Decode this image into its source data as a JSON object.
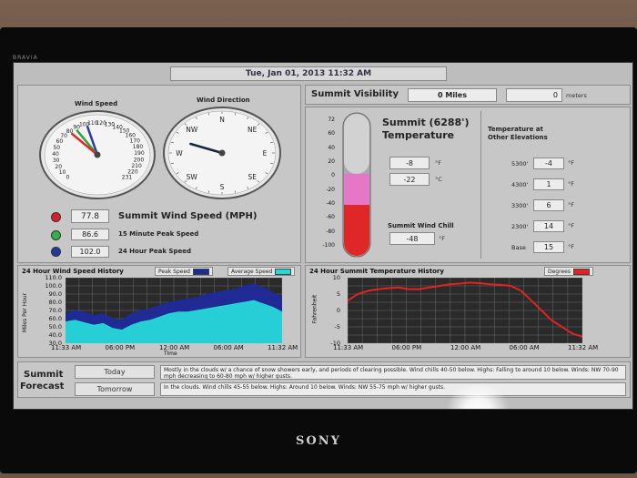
{
  "tv": {
    "brand_top": "BRAVIA",
    "brand_bottom": "SONY"
  },
  "header": {
    "datetime": "Tue, Jan 01, 2013  11:32 AM"
  },
  "wind_speed_gauge": {
    "title": "Wind Speed",
    "ticks": [
      "0",
      "10",
      "20",
      "30",
      "40",
      "50",
      "60",
      "70",
      "80",
      "90",
      "100",
      "110",
      "120",
      "130",
      "140",
      "150",
      "160",
      "170",
      "180",
      "190",
      "200",
      "210",
      "220",
      "231"
    ],
    "needles": [
      {
        "name": "current",
        "value": 77.8,
        "color": "#e3262a"
      },
      {
        "name": "15 minute peak",
        "value": 86.6,
        "color": "#29a33b"
      },
      {
        "name": "24 hour peak",
        "value": 102.0,
        "color": "#2a3b9c"
      }
    ]
  },
  "wind_direction_gauge": {
    "title": "Wind Direction",
    "labels": [
      "N",
      "NE",
      "E",
      "SE",
      "S",
      "SW",
      "W",
      "NW"
    ],
    "direction_degrees": 300
  },
  "wind_readouts": {
    "current": {
      "value": "77.8",
      "label": "Summit Wind Speed (MPH)",
      "led_color": "#d81f26"
    },
    "peak15": {
      "value": "86.6",
      "label": "15 Minute Peak Speed",
      "led_color": "#2fb346"
    },
    "peak24": {
      "value": "102.0",
      "label": "24 Hour Peak Speed",
      "led_color": "#253a9a"
    }
  },
  "visibility": {
    "title": "Summit Visibility",
    "miles": "0 Miles",
    "meters_value": "0",
    "meters_unit": "meters"
  },
  "temperature": {
    "title_line1": "Summit (6288')",
    "title_line2": "Temperature",
    "thermometer_ticks": [
      "72",
      "60",
      "40",
      "20",
      "0",
      "-20",
      "-40",
      "-60",
      "-80",
      "-100"
    ],
    "fahrenheit": "-8",
    "celsius": "-22",
    "f_unit": "°F",
    "c_unit": "°C",
    "wind_chill_label": "Summit Wind Chill",
    "wind_chill": "-48",
    "wind_chill_unit": "°F"
  },
  "elevations": {
    "title_line1": "Temperature at",
    "title_line2": "Other Elevations",
    "rows": [
      {
        "label": "5300'",
        "value": "-4",
        "unit": "°F"
      },
      {
        "label": "4300'",
        "value": "1",
        "unit": "°F"
      },
      {
        "label": "3300'",
        "value": "6",
        "unit": "°F"
      },
      {
        "label": "2300'",
        "value": "14",
        "unit": "°F"
      },
      {
        "label": "Base",
        "value": "15",
        "unit": "°F"
      }
    ]
  },
  "wind_history": {
    "title": "24 Hour Wind Speed History",
    "legend_peak": "Peak Speed",
    "legend_avg": "Average Speed",
    "peak_color": "#1f2a9a",
    "avg_color": "#27d8d8",
    "ylabel": "Miles Per Hour",
    "xlabel": "Time",
    "yticks": [
      "110.0",
      "100.0",
      "90.0",
      "80.0",
      "70.0",
      "60.0",
      "50.0",
      "40.0",
      "30.0"
    ],
    "xticks": [
      "11:33 AM",
      "06:00 PM",
      "12:00 AM",
      "06:00 AM",
      "11:32 AM"
    ]
  },
  "temp_history": {
    "title": "24 Hour Summit Temperature History",
    "legend": "Degrees",
    "line_color": "#e32222",
    "ylabel": "Fahrenheit",
    "yticks": [
      "10",
      "5",
      "0",
      "-5",
      "-10"
    ],
    "xticks": [
      "11:33 AM",
      "06:00 PM",
      "12:00 AM",
      "06:00 AM",
      "11:32 AM"
    ]
  },
  "chart_data": [
    {
      "type": "area",
      "title": "24 Hour Wind Speed History",
      "ylabel": "Miles Per Hour",
      "xlabel": "Time",
      "ylim": [
        30,
        110
      ],
      "xlabels": [
        "11:33 AM",
        "06:00 PM",
        "12:00 AM",
        "06:00 AM",
        "11:32 AM"
      ],
      "grid": true,
      "series": [
        {
          "name": "Peak Speed",
          "values": [
            66,
            70,
            68,
            64,
            66,
            60,
            58,
            66,
            70,
            72,
            76,
            80,
            82,
            84,
            86,
            90,
            92,
            94,
            96,
            100,
            102,
            98,
            92,
            86
          ]
        },
        {
          "name": "Average Speed",
          "values": [
            56,
            58,
            55,
            52,
            54,
            48,
            46,
            52,
            56,
            58,
            62,
            66,
            68,
            68,
            70,
            72,
            74,
            76,
            78,
            80,
            82,
            78,
            74,
            68
          ]
        }
      ]
    },
    {
      "type": "line",
      "title": "24 Hour Summit Temperature History",
      "ylabel": "Fahrenheit",
      "ylim": [
        -10,
        10
      ],
      "xlabels": [
        "11:33 AM",
        "06:00 PM",
        "12:00 AM",
        "06:00 AM",
        "11:32 AM"
      ],
      "grid": true,
      "series": [
        {
          "name": "Degrees",
          "values": [
            3,
            5,
            6,
            6.5,
            6.8,
            7,
            6.5,
            6.5,
            7,
            7.5,
            8,
            8.2,
            8.5,
            8.3,
            8,
            7.8,
            7.5,
            6,
            3,
            0,
            -3,
            -5,
            -7,
            -8
          ]
        }
      ]
    }
  ],
  "forecast": {
    "title_line1": "Summit",
    "title_line2": "Forecast",
    "today_label": "Today",
    "tomorrow_label": "Tomorrow",
    "today_text": "Mostly in the clouds w/ a chance of snow showers early, and periods of clearing possible. Wind chills 40-50 below.  Highs: Falling to around 10 below.  Winds: NW 70-90 mph decreasing to 60-80 mph w/ higher gusts.",
    "tomorrow_text": "In the clouds. Wind chills 45-55 below.  Highs: Around 10 below.  Winds: NW 55-75 mph w/ higher gusts."
  }
}
